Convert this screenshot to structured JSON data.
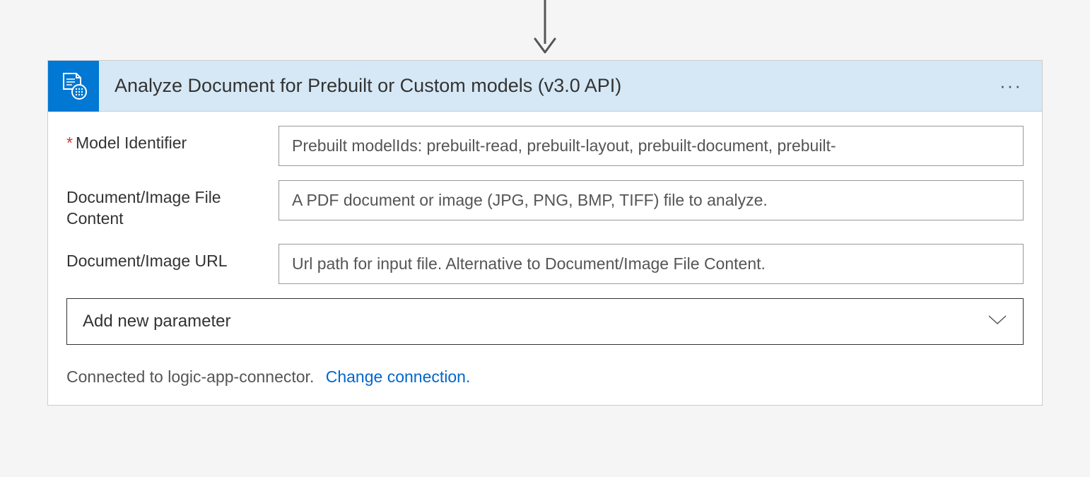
{
  "card": {
    "title": "Analyze Document for Prebuilt or Custom models (v3.0 API)"
  },
  "fields": {
    "modelIdentifier": {
      "label": "Model Identifier",
      "required": true,
      "placeholder": "Prebuilt modelIds: prebuilt-read, prebuilt-layout, prebuilt-document, prebuilt-"
    },
    "fileContent": {
      "label": "Document/Image File Content",
      "required": false,
      "placeholder": "A PDF document or image (JPG, PNG, BMP, TIFF) file to analyze."
    },
    "url": {
      "label": "Document/Image URL",
      "required": false,
      "placeholder": "Url path for input file. Alternative to Document/Image File Content."
    }
  },
  "dropdown": {
    "label": "Add new parameter"
  },
  "footer": {
    "connectedText": "Connected to logic-app-connector.",
    "changeLinkText": "Change connection."
  }
}
